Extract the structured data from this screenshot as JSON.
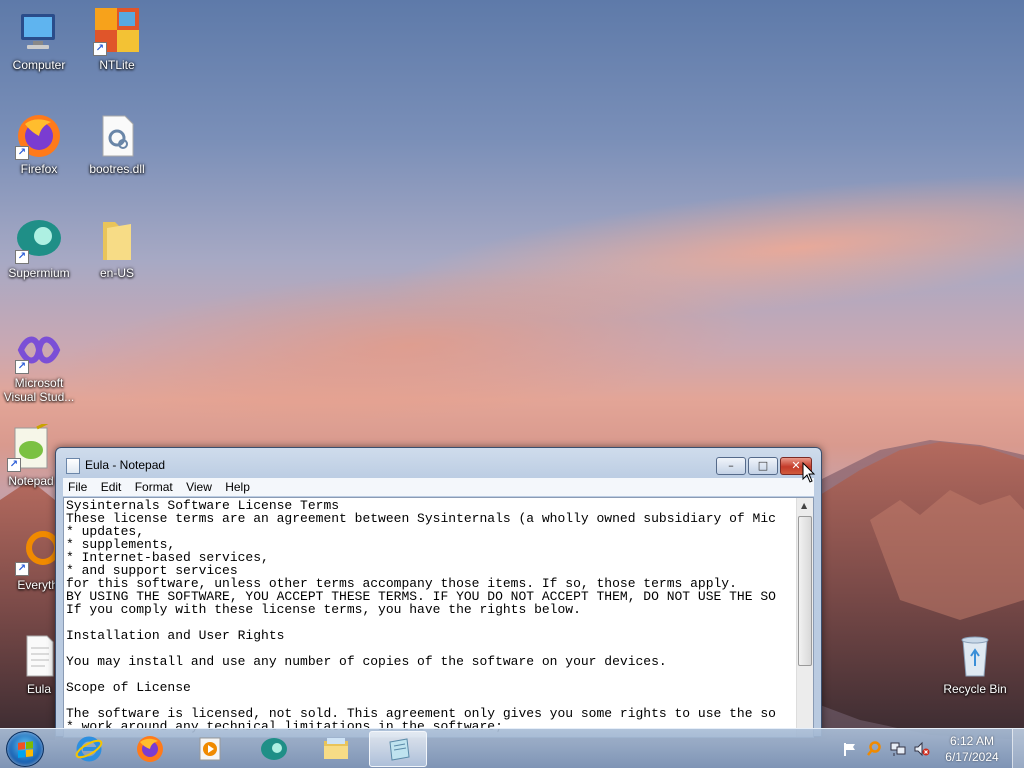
{
  "desktop": {
    "icons": [
      {
        "label": "Computer"
      },
      {
        "label": "NTLite"
      },
      {
        "label": "Firefox"
      },
      {
        "label": "bootres.dll"
      },
      {
        "label": "Supermium"
      },
      {
        "label": "en-US"
      },
      {
        "label": "Microsoft Visual Stud..."
      },
      {
        "label": "Notepad"
      },
      {
        "label": "Everythi"
      },
      {
        "label": "Eula"
      },
      {
        "label": "Recycle Bin"
      }
    ]
  },
  "notepad": {
    "title": "Eula - Notepad",
    "menu": [
      "File",
      "Edit",
      "Format",
      "View",
      "Help"
    ],
    "content": "Sysinternals Software License Terms\nThese license terms are an agreement between Sysinternals (a wholly owned subsidiary of Mic\n* updates,\n* supplements,\n* Internet-based services,\n* and support services\nfor this software, unless other terms accompany those items. If so, those terms apply.\nBY USING THE SOFTWARE, YOU ACCEPT THESE TERMS. IF YOU DO NOT ACCEPT THEM, DO NOT USE THE SO\nIf you comply with these license terms, you have the rights below.\n\nInstallation and User Rights\n\nYou may install and use any number of copies of the software on your devices.\n\nScope of License\n\nThe software is licensed, not sold. This agreement only gives you some rights to use the so\n* work around any technical limitations in the software;",
    "caption_buttons": {
      "minimize": "–",
      "maximize": "□",
      "close": "✕"
    }
  },
  "taskbar": {
    "pinned": [
      "internet-explorer-icon",
      "firefox-icon",
      "media-player-icon",
      "supermium-icon",
      "file-explorer-icon",
      "notepad-icon"
    ],
    "clock": {
      "time": "6:12 AM",
      "date": "6/17/2024"
    }
  }
}
